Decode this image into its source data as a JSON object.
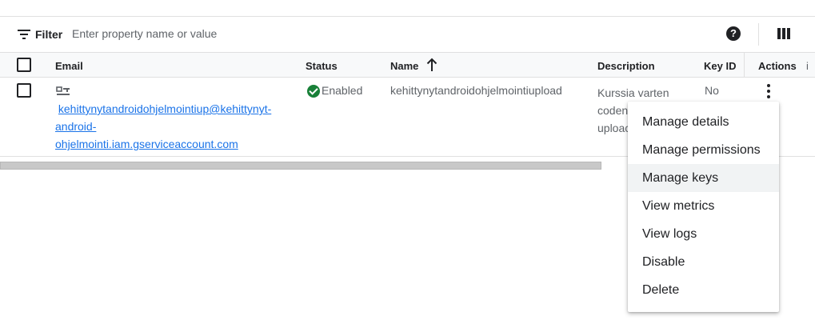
{
  "filter": {
    "label": "Filter",
    "placeholder": "Enter property name or value",
    "help_icon": "help-icon",
    "columns_icon": "view-columns-icon"
  },
  "table": {
    "columns": {
      "email": "Email",
      "status": "Status",
      "name": "Name",
      "description": "Description",
      "key_id": "Key ID",
      "actions": "Actions",
      "extra": "i"
    },
    "sort": {
      "column": "Name",
      "direction": "ascending"
    },
    "rows": [
      {
        "email_line1": "kehittynytandroidohjelmointiup@kehittynyt-",
        "email_line2": "android-",
        "email_line3": "ohjelmointi.iam.gserviceaccount.com",
        "status": "Enabled",
        "name": "kehittynytandroidohjelmointiupload",
        "description": "Kurssia varten\ncoden\nuploac",
        "key_id": "No"
      }
    ]
  },
  "menu": {
    "items": [
      "Manage details",
      "Manage permissions",
      "Manage keys",
      "View metrics",
      "View logs",
      "Disable",
      "Delete"
    ],
    "hovered": "Manage keys"
  },
  "colors": {
    "link": "#1a73e8",
    "status_ok": "#188038",
    "text": "#202124",
    "muted": "#5f6368"
  }
}
